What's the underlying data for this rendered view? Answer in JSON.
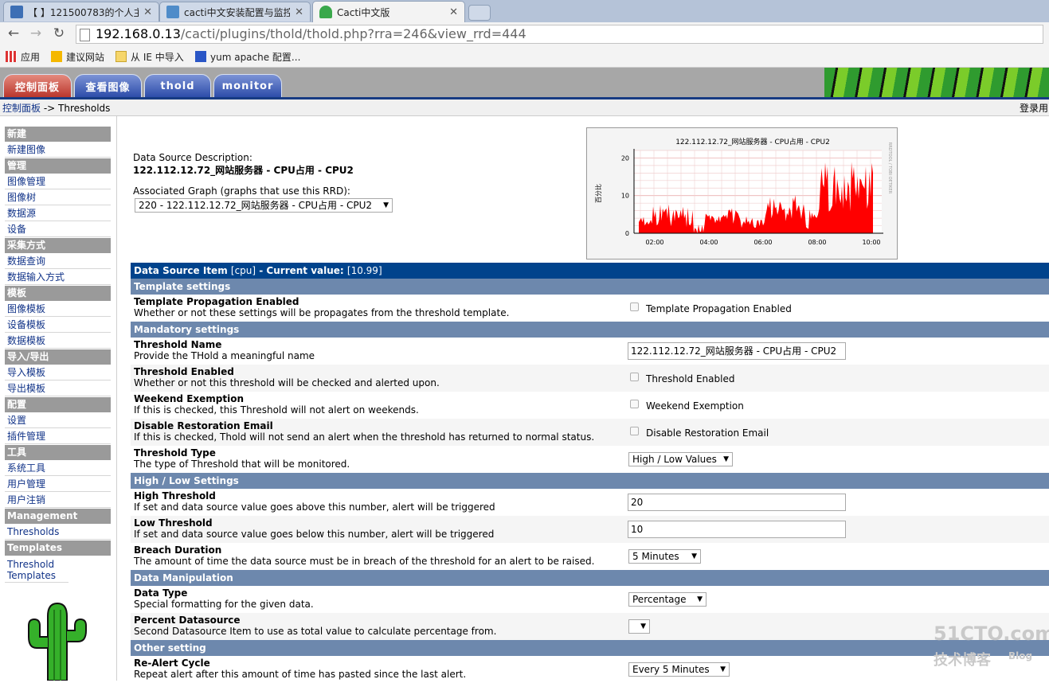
{
  "browser": {
    "tabs": [
      {
        "title": "【 】121500783的个人主",
        "icon": "home-icon"
      },
      {
        "title": "cacti中文安装配置与监控",
        "icon": "page-icon"
      },
      {
        "title": "Cacti中文版",
        "icon": "cacti-icon"
      }
    ],
    "url_host": "192.168.0.13",
    "url_path": "/cacti/plugins/thold/thold.php?rra=246&view_rrd=444",
    "bookmarks": [
      {
        "label": "应用",
        "icon": "apps-grid-icon"
      },
      {
        "label": "建议网站",
        "icon": "bing-icon"
      },
      {
        "label": "从 IE 中导入",
        "icon": "folder-icon"
      },
      {
        "label": "yum apache 配置...",
        "icon": "paw-icon"
      }
    ]
  },
  "header": {
    "tabs": [
      "控制面板",
      "查看图像",
      "thold",
      "monitor"
    ],
    "breadcrumb_link": "控制面板",
    "breadcrumb_rest": " -> Thresholds",
    "login": "登录用"
  },
  "sidebar": {
    "items": [
      {
        "label": "新建",
        "type": "head"
      },
      {
        "label": "新建图像",
        "type": "link"
      },
      {
        "label": "管理",
        "type": "head"
      },
      {
        "label": "图像管理",
        "type": "link"
      },
      {
        "label": "图像树",
        "type": "link"
      },
      {
        "label": "数据源",
        "type": "link"
      },
      {
        "label": "设备",
        "type": "link"
      },
      {
        "label": "采集方式",
        "type": "head"
      },
      {
        "label": "数据查询",
        "type": "link"
      },
      {
        "label": "数据输入方式",
        "type": "link"
      },
      {
        "label": "模板",
        "type": "head"
      },
      {
        "label": "图像模板",
        "type": "link"
      },
      {
        "label": "设备模板",
        "type": "link"
      },
      {
        "label": "数据模板",
        "type": "link"
      },
      {
        "label": "导入/导出",
        "type": "head"
      },
      {
        "label": "导入模板",
        "type": "link"
      },
      {
        "label": "导出模板",
        "type": "link"
      },
      {
        "label": "配置",
        "type": "head"
      },
      {
        "label": "设置",
        "type": "link"
      },
      {
        "label": "插件管理",
        "type": "link"
      },
      {
        "label": "工具",
        "type": "head"
      },
      {
        "label": "系统工具",
        "type": "link"
      },
      {
        "label": "用户管理",
        "type": "link"
      },
      {
        "label": "用户注销",
        "type": "link"
      },
      {
        "label": "Management",
        "type": "head"
      },
      {
        "label": "Thresholds",
        "type": "link"
      },
      {
        "label": "Templates",
        "type": "head"
      },
      {
        "label": "Threshold Templates",
        "type": "link"
      }
    ]
  },
  "source": {
    "desc_label": "Data Source Description:",
    "desc_value": "122.112.12.72_网站服务器 - CPU占用 - CPU2",
    "assoc_label": "Associated Graph (graphs that use this RRD):",
    "assoc_value": "220 - 122.112.12.72_网站服务器 - CPU占用 - CPU2"
  },
  "graph": {
    "title": "122.112.12.72_网站服务器 - CPU占用 - CPU2",
    "ylabel": "百分比",
    "side_label": "RRDTOOL / TOBI OETIKER",
    "yticks": [
      "20",
      "10",
      "0"
    ],
    "xticks": [
      "02:00",
      "04:00",
      "06:00",
      "08:00",
      "10:00"
    ],
    "color": "#ff0000"
  },
  "form": {
    "item_label": "Data Source Item",
    "item_value": "[cpu]",
    "current_label": "- Current value:",
    "current_value": "[10.99]",
    "sections": {
      "template": "Template settings",
      "mandatory": "Mandatory settings",
      "highlow": "High / Low Settings",
      "manip": "Data Manipulation",
      "other": "Other setting"
    },
    "rows": {
      "tpl_prop": {
        "title": "Template Propagation Enabled",
        "desc": "Whether or not these settings will be propagates from the threshold template.",
        "check_label": "Template Propagation Enabled"
      },
      "name": {
        "title": "Threshold Name",
        "desc": "Provide the THold a meaningful name",
        "value": "122.112.12.72_网站服务器 - CPU占用 - CPU2"
      },
      "enabled": {
        "title": "Threshold Enabled",
        "desc": "Whether or not this threshold will be checked and alerted upon.",
        "check_label": "Threshold Enabled"
      },
      "weekend": {
        "title": "Weekend Exemption",
        "desc": "If this is checked, this Threshold will not alert on weekends.",
        "check_label": "Weekend Exemption"
      },
      "restore": {
        "title": "Disable Restoration Email",
        "desc": "If this is checked, Thold will not send an alert when the threshold has returned to normal status.",
        "check_label": "Disable Restoration Email"
      },
      "type": {
        "title": "Threshold Type",
        "desc": "The type of Threshold that will be monitored.",
        "value": "High / Low Values"
      },
      "high": {
        "title": "High Threshold",
        "desc": "If set and data source value goes above this number, alert will be triggered",
        "value": "20"
      },
      "low": {
        "title": "Low Threshold",
        "desc": "If set and data source value goes below this number, alert will be triggered",
        "value": "10"
      },
      "breach": {
        "title": "Breach Duration",
        "desc": "The amount of time the data source must be in breach of the threshold for an alert to be raised.",
        "value": "5 Minutes"
      },
      "dtype": {
        "title": "Data Type",
        "desc": "Special formatting for the given data.",
        "value": "Percentage"
      },
      "pct": {
        "title": "Percent Datasource",
        "desc": "Second Datasource Item to use as total value to calculate percentage from.",
        "value": ""
      },
      "realert": {
        "title": "Re-Alert Cycle",
        "desc": "Repeat alert after this amount of time has pasted since the last alert.",
        "value": "Every 5 Minutes"
      }
    }
  },
  "watermark": {
    "top": "51CTO.com",
    "bottom": "技术博客",
    "tag": "Blog"
  }
}
